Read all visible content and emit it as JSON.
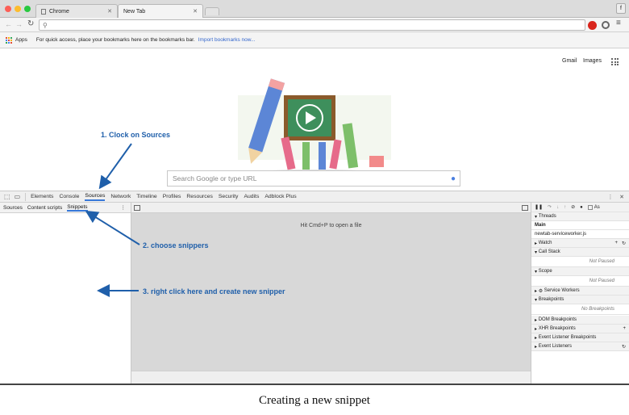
{
  "browser": {
    "tabs": [
      {
        "label": "Chrome"
      },
      {
        "label": "New Tab"
      }
    ],
    "window_corner": "f",
    "bookmarks_bar": {
      "apps_label": "Apps",
      "hint": "For quick access, place your bookmarks here on the bookmarks bar.",
      "import_link": "Import bookmarks now..."
    }
  },
  "newtab": {
    "links": {
      "gmail": "Gmail",
      "images": "Images"
    },
    "search_placeholder": "Search Google or type URL"
  },
  "devtools": {
    "tabs": [
      "Elements",
      "Console",
      "Sources",
      "Network",
      "Timeline",
      "Profiles",
      "Resources",
      "Security",
      "Audits",
      "Adblock Plus"
    ],
    "active_tab": "Sources",
    "navigator_tabs": [
      "Sources",
      "Content scripts",
      "Snippets"
    ],
    "active_navigator_tab": "Snippets",
    "editor_hint": "Hit Cmd+P to open a file",
    "sidebar": {
      "async_label": "As",
      "threads": "Threads",
      "main": "Main",
      "worker": "newtab-serviceworker.js",
      "watch": "Watch",
      "call_stack": "Call Stack",
      "call_stack_status": "Not Paused",
      "scope": "Scope",
      "scope_status": "Not Paused",
      "service_workers": "Service Workers",
      "breakpoints": "Breakpoints",
      "breakpoints_status": "No Breakpoints",
      "dom_breakpoints": "DOM Breakpoints",
      "xhr_breakpoints": "XHR Breakpoints",
      "event_listener_breakpoints": "Event Listener Breakpoints",
      "event_listeners": "Event Listeners"
    }
  },
  "annotations": {
    "step1": "1. Clock on Sources",
    "step2": "2. choose snippers",
    "step3": "3. right click here and create new snipper"
  },
  "caption": "Creating a new snippet",
  "colors": {
    "annotation": "#1f5faa",
    "chalkboard": "#3e8f5c"
  }
}
